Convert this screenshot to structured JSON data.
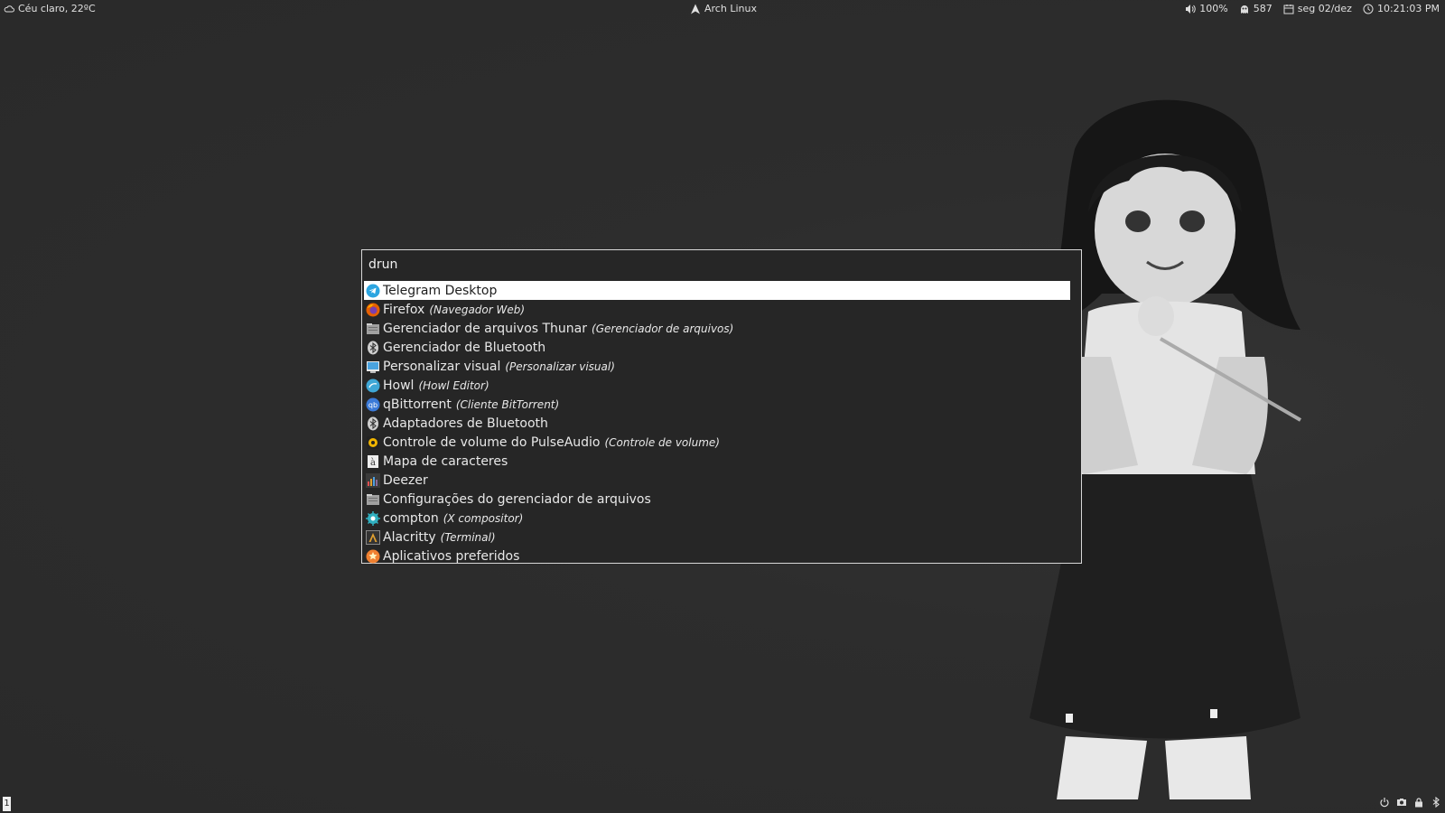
{
  "topbar": {
    "weather": "Céu claro, 22ºC",
    "distro": "Arch Linux",
    "volume": "100%",
    "updates": "587",
    "date": "seg 02/dez",
    "time": "10:21:03 PM"
  },
  "launcher": {
    "prompt": "drun",
    "entries": [
      {
        "name": "Telegram Desktop",
        "desc": "",
        "icon": "telegram-icon",
        "color": "#2ca5e0"
      },
      {
        "name": "Firefox",
        "desc": "(Navegador Web)",
        "icon": "firefox-icon",
        "color": "#e66000"
      },
      {
        "name": "Gerenciador de arquivos Thunar",
        "desc": "(Gerenciador de arquivos)",
        "icon": "file-manager-icon",
        "color": "#a0a0a0"
      },
      {
        "name": "Gerenciador de Bluetooth",
        "desc": "",
        "icon": "bluetooth-icon",
        "color": "#cfcfcf"
      },
      {
        "name": "Personalizar visual",
        "desc": "(Personalizar visual)",
        "icon": "appearance-icon",
        "color": "#4aa3df"
      },
      {
        "name": "Howl",
        "desc": "(Howl Editor)",
        "icon": "howl-icon",
        "color": "#3fa7d6"
      },
      {
        "name": "qBittorrent",
        "desc": "(Cliente BitTorrent)",
        "icon": "qbittorrent-icon",
        "color": "#3b7ad8"
      },
      {
        "name": "Adaptadores de Bluetooth",
        "desc": "",
        "icon": "bluetooth-icon",
        "color": "#cfcfcf"
      },
      {
        "name": "Controle de volume do PulseAudio",
        "desc": "(Controle de volume)",
        "icon": "pulseaudio-icon",
        "color": "#f0b400"
      },
      {
        "name": "Mapa de caracteres",
        "desc": "",
        "icon": "charmap-icon",
        "color": "#bbbbbb"
      },
      {
        "name": "Deezer",
        "desc": "",
        "icon": "deezer-icon",
        "color": "#8a6a9a"
      },
      {
        "name": "Configurações do gerenciador de arquivos",
        "desc": "",
        "icon": "file-manager-settings-icon",
        "color": "#a0a0a0"
      },
      {
        "name": "compton",
        "desc": "(X compositor)",
        "icon": "compton-icon",
        "color": "#30b0c0"
      },
      {
        "name": "Alacritty",
        "desc": "(Terminal)",
        "icon": "terminal-icon",
        "color": "#e0a030"
      },
      {
        "name": "Aplicativos preferidos",
        "desc": "",
        "icon": "preferred-apps-icon",
        "color": "#f08030"
      }
    ]
  },
  "bottombar": {
    "workspace": "1"
  }
}
